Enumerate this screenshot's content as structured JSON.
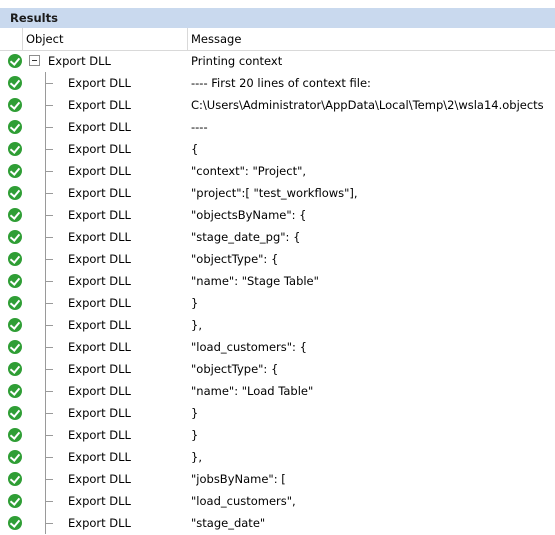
{
  "panel": {
    "title": "Results"
  },
  "columns": {
    "object": "Object",
    "message": "Message"
  },
  "rows": [
    {
      "object": "Export DLL",
      "message": "Printing context",
      "parent": true
    },
    {
      "object": "Export DLL",
      "message": "---- First 20 lines of context file:"
    },
    {
      "object": "Export DLL",
      "message": "C:\\Users\\Administrator\\AppData\\Local\\Temp\\2\\wsla14.objects"
    },
    {
      "object": "Export DLL",
      "message": "----"
    },
    {
      "object": "Export DLL",
      "message": "{"
    },
    {
      "object": "Export DLL",
      "message": "\"context\": \"Project\","
    },
    {
      "object": "Export DLL",
      "message": "\"project\":[ \"test_workflows\"],"
    },
    {
      "object": "Export DLL",
      "message": "\"objectsByName\": {"
    },
    {
      "object": "Export DLL",
      "message": "\"stage_date_pg\": {"
    },
    {
      "object": "Export DLL",
      "message": "\"objectType\": {"
    },
    {
      "object": "Export DLL",
      "message": "\"name\": \"Stage Table\""
    },
    {
      "object": "Export DLL",
      "message": "}"
    },
    {
      "object": "Export DLL",
      "message": "},"
    },
    {
      "object": "Export DLL",
      "message": "\"load_customers\": {"
    },
    {
      "object": "Export DLL",
      "message": "\"objectType\": {"
    },
    {
      "object": "Export DLL",
      "message": "\"name\": \"Load Table\""
    },
    {
      "object": "Export DLL",
      "message": "}"
    },
    {
      "object": "Export DLL",
      "message": "}"
    },
    {
      "object": "Export DLL",
      "message": "},"
    },
    {
      "object": "Export DLL",
      "message": "\"jobsByName\": ["
    },
    {
      "object": "Export DLL",
      "message": "\"load_customers\","
    },
    {
      "object": "Export DLL",
      "message": "\"stage_date\""
    }
  ],
  "icons": {
    "status": "check-circle-icon",
    "expander": "collapse-minus-icon"
  },
  "colors": {
    "success": "#2f9e35",
    "title_bg": "#c9d9ee"
  }
}
